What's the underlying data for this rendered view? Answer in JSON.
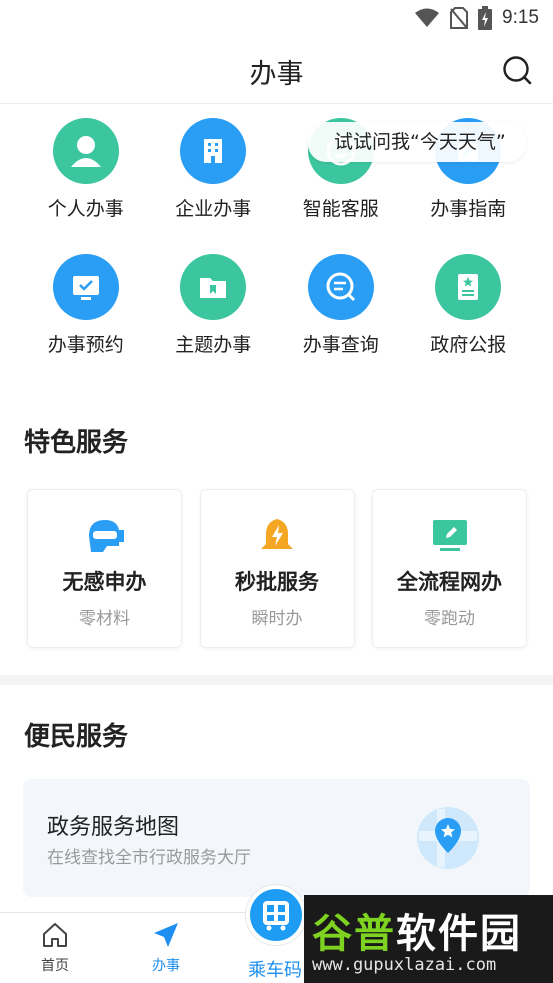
{
  "status_bar": {
    "time": "9:15"
  },
  "header": {
    "title": "办事"
  },
  "quick_actions": [
    {
      "label": "个人办事",
      "icon": "person-icon",
      "color": "#3cc6a0"
    },
    {
      "label": "企业办事",
      "icon": "building-icon",
      "color": "#2a9df4"
    },
    {
      "label": "智能客服",
      "icon": "chat-service-icon",
      "color": "#3cc6a0"
    },
    {
      "label": "办事指南",
      "icon": "guide-icon",
      "color": "#2a9df4"
    },
    {
      "label": "办事预约",
      "icon": "monitor-check-icon",
      "color": "#2a9df4"
    },
    {
      "label": "主题办事",
      "icon": "folder-bookmark-icon",
      "color": "#3cc6a0"
    },
    {
      "label": "办事查询",
      "icon": "search-doc-icon",
      "color": "#2a9df4"
    },
    {
      "label": "政府公报",
      "icon": "bulletin-icon",
      "color": "#3cc6a0"
    }
  ],
  "assistant_tip": "试试问我“今天天气”",
  "feature_section": {
    "title": "特色服务",
    "cards": [
      {
        "title": "无感申办",
        "subtitle": "零材料",
        "icon": "vr-headset-icon"
      },
      {
        "title": "秒批服务",
        "subtitle": "瞬时办",
        "icon": "bell-lightning-icon"
      },
      {
        "title": "全流程网办",
        "subtitle": "零跑动",
        "icon": "screen-edit-icon"
      }
    ]
  },
  "convenience_section": {
    "title": "便民服务",
    "map_card": {
      "title": "政务服务地图",
      "subtitle": "在线查找全市行政服务大厅",
      "icon": "map-pin-icon"
    }
  },
  "tab_bar": {
    "tabs": [
      {
        "label": "首页",
        "icon": "home-icon"
      },
      {
        "label": "办事",
        "icon": "send-icon"
      }
    ],
    "center": {
      "label": "乘车码",
      "icon": "bus-qr-icon"
    }
  },
  "watermark": {
    "brand": "谷普软件园",
    "url": "www.gupuxlazai.com"
  },
  "colors": {
    "accent": "#1e8ff0",
    "green": "#3cc6a0",
    "blue": "#2a9df4"
  }
}
